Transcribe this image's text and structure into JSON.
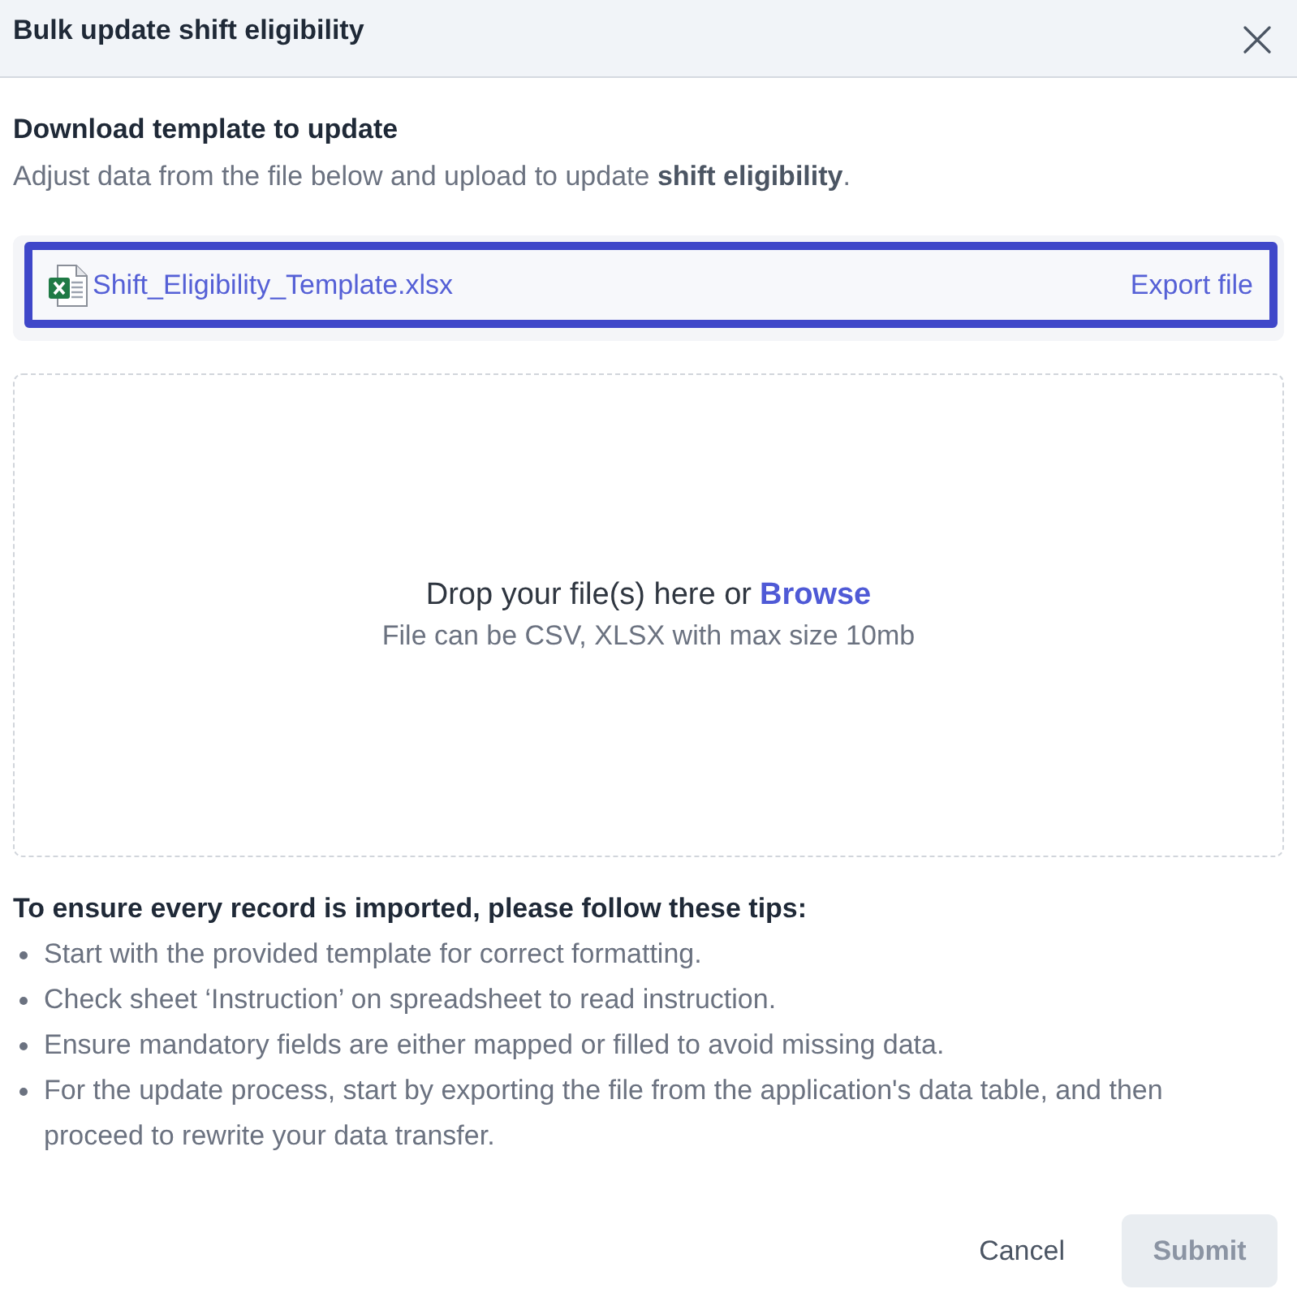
{
  "dialog": {
    "title": "Bulk update shift eligibility"
  },
  "download_section": {
    "heading": "Download template to update",
    "description": "Adjust data from the file below and upload to update **shift eligibility**."
  },
  "template_file": {
    "name": "Shift_Eligibility_Template.xlsx",
    "action": "Export file",
    "focused": true
  },
  "dropzone": {
    "prompt": "Drop your file(s) here or",
    "link": "Browse",
    "hint": "File can be CSV, XLSX with max size 10mb"
  },
  "tips": {
    "heading": "To ensure every record is imported, please follow these tips:",
    "items": [
      "Start with the provided template for correct formatting.",
      "Check sheet ‘Instruction’ on spreadsheet to read instruction.",
      "Ensure mandatory fields are either mapped or filled to avoid missing data.",
      "For the update process, start by exporting the file from the application's data table, and then proceed to rewrite your data transfer."
    ]
  },
  "buttons": [
    {
      "label": "Cancel",
      "kind": "text",
      "disabled": false
    },
    {
      "label": "Submit",
      "kind": "primary",
      "disabled": true
    }
  ]
}
